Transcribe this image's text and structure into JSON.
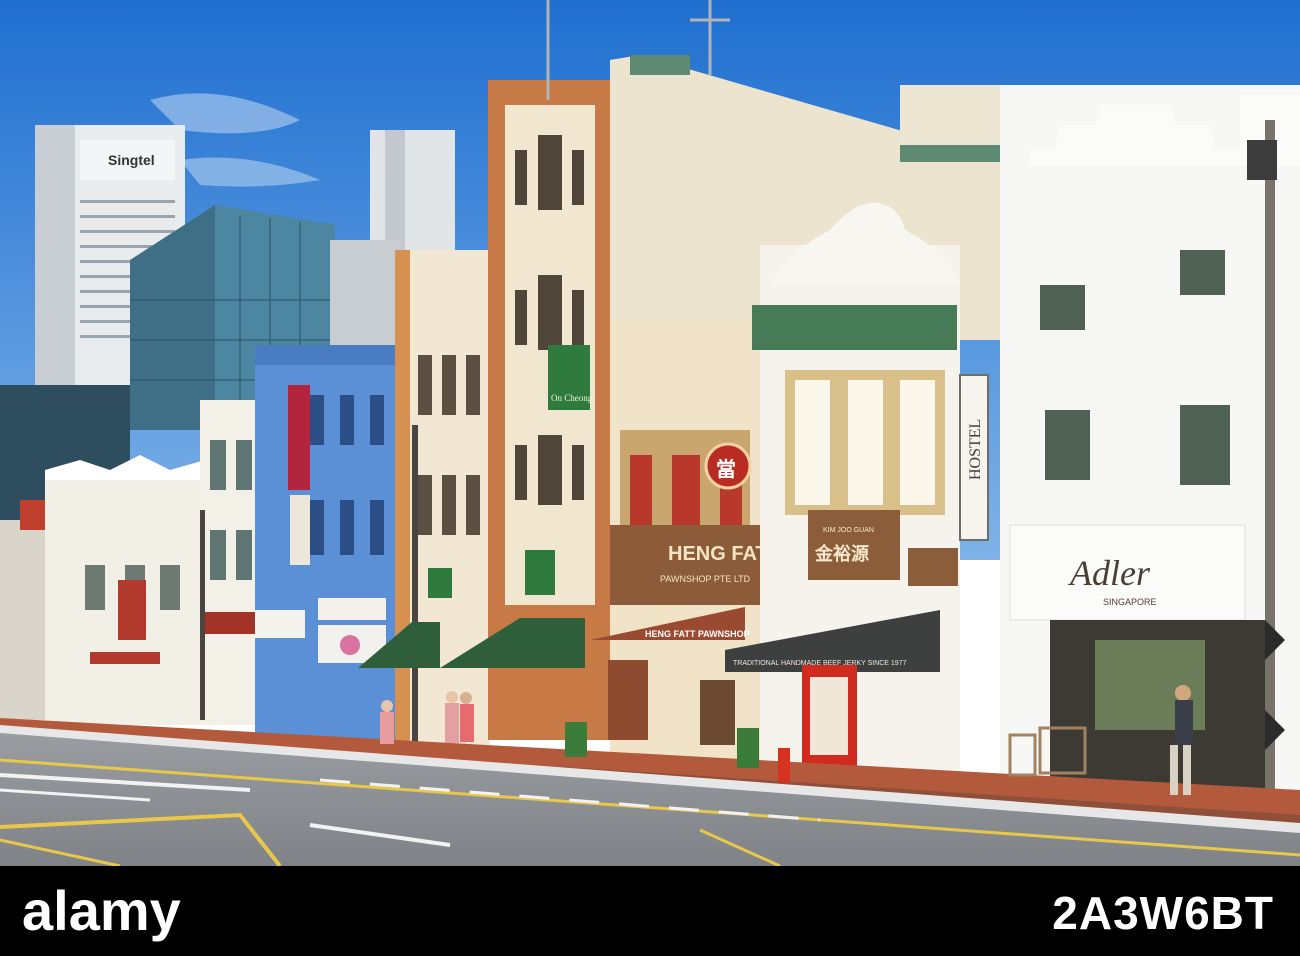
{
  "signs": {
    "singtel": "Singtel",
    "on_cheong": "On Cheong",
    "heng_fatt": "HENG FATT",
    "pawnshop_pte": "PAWNSHOP PTE LTD",
    "heng_fatt_awning": "HENG FATT PAWNSHOP",
    "kim_joo_guan_chinese": "金裕源",
    "kim_joo_guan_roman": "KIM JOO GUAN",
    "hostel": "HOSTEL",
    "adler": "Adler",
    "adler_sub": "SINGAPORE",
    "traditional": "TRADITIONAL HANDMADE BEEF JERKY SINCE 1977",
    "ding": "當"
  },
  "watermark": {
    "brand": "alamy",
    "image_id": "2A3W6BT"
  },
  "colors": {
    "sky": "#2f7fd8",
    "road": "#8e9196",
    "blue_shophouse": "#5b8fd6",
    "orange_building": "#c77a46",
    "green_awning": "#2e5e3a",
    "footer": "#000000"
  }
}
